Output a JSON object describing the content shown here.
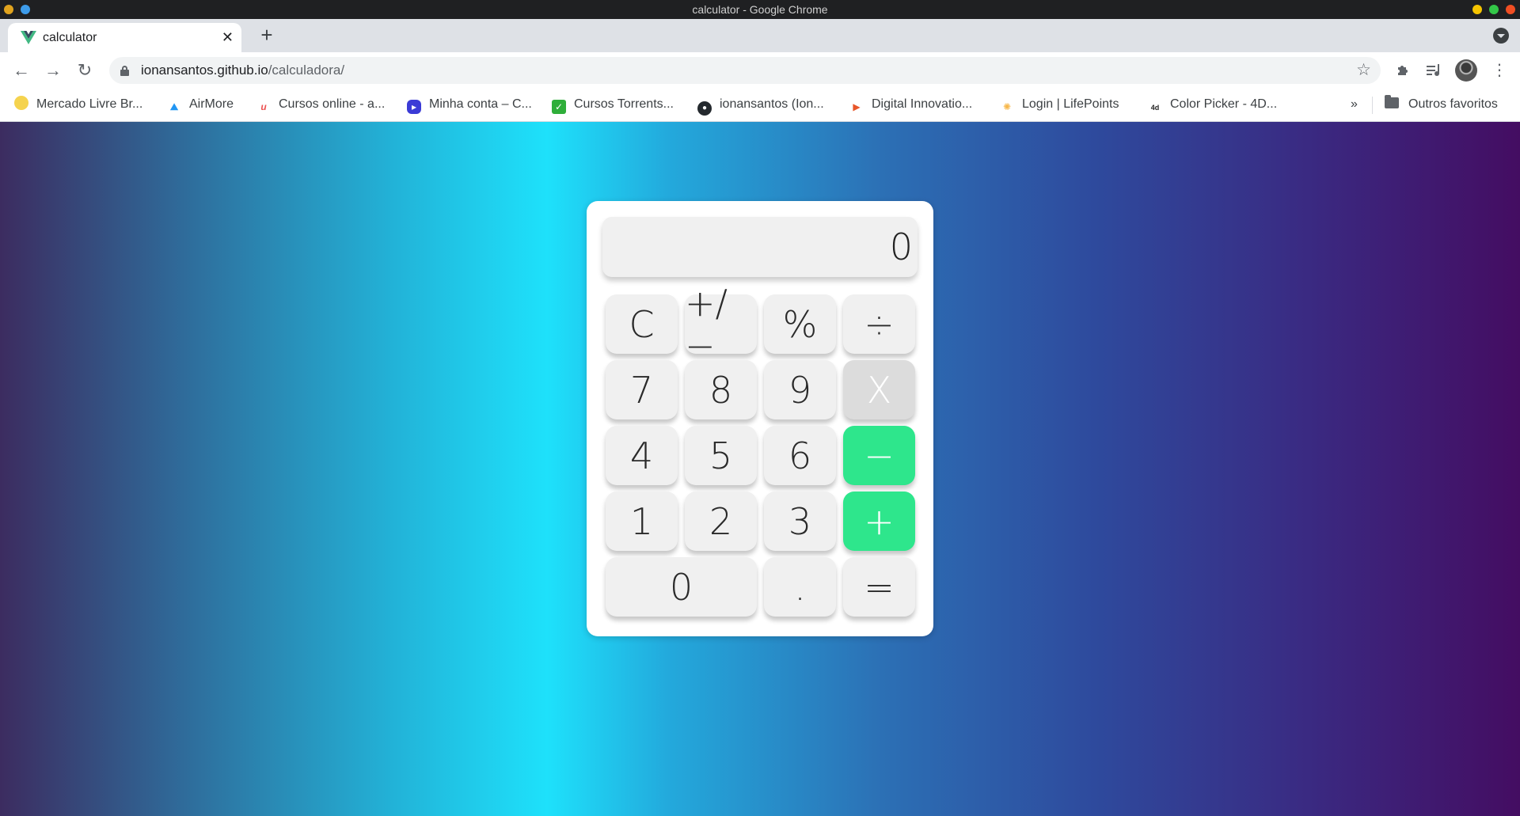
{
  "os": {
    "window_title": "calculator - Google Chrome",
    "left_dots": [
      "#e0a31e",
      "#3d9be9"
    ],
    "right_dots": [
      "#f5c400",
      "#33c748",
      "#f04e23"
    ]
  },
  "browser": {
    "tab": {
      "title": "calculator",
      "close": "✕",
      "favicon": "vue-logo-icon"
    },
    "new_tab": "+",
    "nav": {
      "back": "←",
      "forward": "→",
      "reload": "↻"
    },
    "url": {
      "host": "ionansantos.github.io",
      "path": "/calculadora/"
    },
    "star": "☆",
    "toolbar_icons": {
      "extensions": "puzzle-icon",
      "media": "media-queue-icon",
      "menu": "⋮"
    }
  },
  "bookmarks": {
    "items": [
      {
        "label": "Mercado Livre Br...",
        "icon": "mercado-livre-icon",
        "color": "#f5d34e"
      },
      {
        "label": "AirMore",
        "icon": "airmore-icon",
        "color": "#2196f3"
      },
      {
        "label": "Cursos online - a...",
        "icon": "udemy-icon",
        "color": "#ec5252"
      },
      {
        "label": "Minha conta – C...",
        "icon": "minha-conta-icon",
        "color": "#3b3bd6"
      },
      {
        "label": "Cursos Torrents...",
        "icon": "cursos-torrents-icon",
        "color": "#2fae3a"
      },
      {
        "label": "ionansantos (Ion...",
        "icon": "github-icon",
        "color": "#24292e"
      },
      {
        "label": "Digital Innovatio...",
        "icon": "dio-icon",
        "color": "#e8562a"
      },
      {
        "label": "Login | LifePoints",
        "icon": "lifepoints-icon",
        "color": "#f7b84b"
      },
      {
        "label": "Color Picker - 4D...",
        "icon": "color-picker-icon",
        "color": "#222222"
      }
    ],
    "overflow": "»",
    "other": "Outros favoritos"
  },
  "calculator": {
    "display": "0",
    "keys": [
      {
        "label": "C",
        "name": "clear-button",
        "style": "normal"
      },
      {
        "label": "+/−",
        "name": "sign-toggle-button",
        "style": "normal"
      },
      {
        "label": "%",
        "name": "percent-button",
        "style": "normal"
      },
      {
        "label": "÷",
        "name": "divide-button",
        "style": "normal"
      },
      {
        "label": "7",
        "name": "digit-7-button",
        "style": "normal"
      },
      {
        "label": "8",
        "name": "digit-8-button",
        "style": "normal"
      },
      {
        "label": "9",
        "name": "digit-9-button",
        "style": "normal"
      },
      {
        "label": "X",
        "name": "multiply-button",
        "style": "active"
      },
      {
        "label": "4",
        "name": "digit-4-button",
        "style": "normal"
      },
      {
        "label": "5",
        "name": "digit-5-button",
        "style": "normal"
      },
      {
        "label": "6",
        "name": "digit-6-button",
        "style": "normal"
      },
      {
        "label": "−",
        "name": "subtract-button",
        "style": "green"
      },
      {
        "label": "1",
        "name": "digit-1-button",
        "style": "normal"
      },
      {
        "label": "2",
        "name": "digit-2-button",
        "style": "normal"
      },
      {
        "label": "3",
        "name": "digit-3-button",
        "style": "normal"
      },
      {
        "label": "+",
        "name": "add-button",
        "style": "green"
      },
      {
        "label": "0",
        "name": "digit-0-button",
        "style": "zero"
      },
      {
        "label": ".",
        "name": "decimal-button",
        "style": "normal"
      },
      {
        "label": "=",
        "name": "equals-button",
        "style": "normal"
      }
    ],
    "accent_color": "#2ee68c"
  }
}
